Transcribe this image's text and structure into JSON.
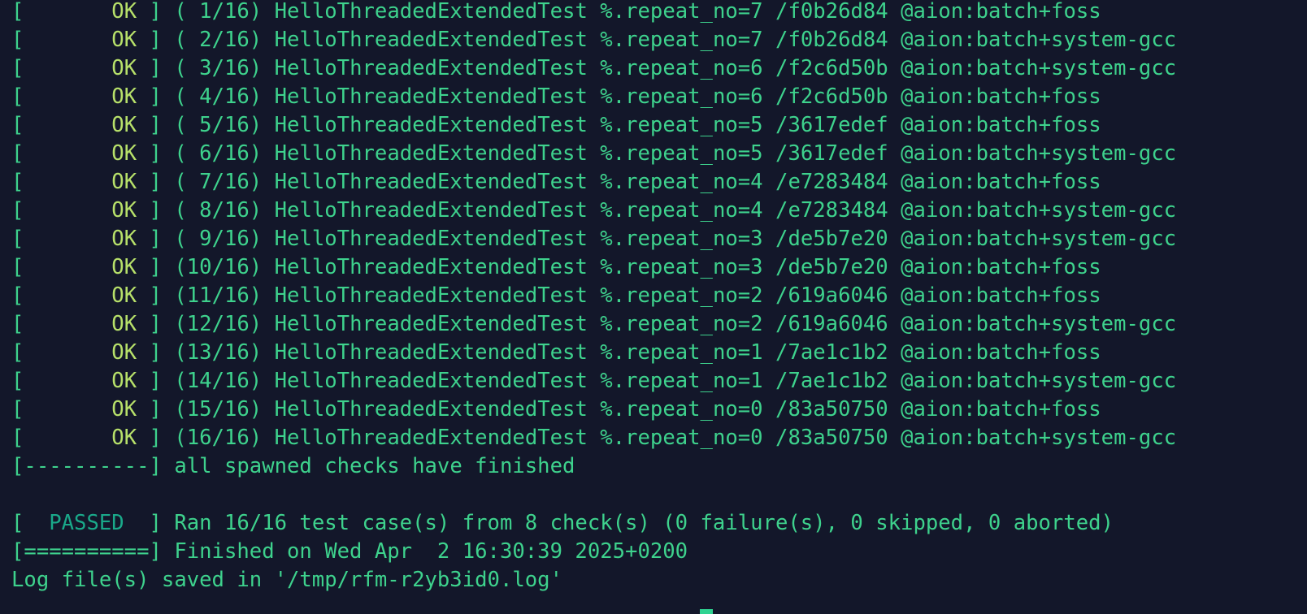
{
  "terminal": {
    "results": [
      {
        "status": "OK",
        "index": "( 1/16)",
        "test": "HelloThreadedExtendedTest",
        "param": "%.repeat_no=7",
        "hash": "/f0b26d84",
        "target": "@aion:batch+foss"
      },
      {
        "status": "OK",
        "index": "( 2/16)",
        "test": "HelloThreadedExtendedTest",
        "param": "%.repeat_no=7",
        "hash": "/f0b26d84",
        "target": "@aion:batch+system-gcc"
      },
      {
        "status": "OK",
        "index": "( 3/16)",
        "test": "HelloThreadedExtendedTest",
        "param": "%.repeat_no=6",
        "hash": "/f2c6d50b",
        "target": "@aion:batch+system-gcc"
      },
      {
        "status": "OK",
        "index": "( 4/16)",
        "test": "HelloThreadedExtendedTest",
        "param": "%.repeat_no=6",
        "hash": "/f2c6d50b",
        "target": "@aion:batch+foss"
      },
      {
        "status": "OK",
        "index": "( 5/16)",
        "test": "HelloThreadedExtendedTest",
        "param": "%.repeat_no=5",
        "hash": "/3617edef",
        "target": "@aion:batch+foss"
      },
      {
        "status": "OK",
        "index": "( 6/16)",
        "test": "HelloThreadedExtendedTest",
        "param": "%.repeat_no=5",
        "hash": "/3617edef",
        "target": "@aion:batch+system-gcc"
      },
      {
        "status": "OK",
        "index": "( 7/16)",
        "test": "HelloThreadedExtendedTest",
        "param": "%.repeat_no=4",
        "hash": "/e7283484",
        "target": "@aion:batch+foss"
      },
      {
        "status": "OK",
        "index": "( 8/16)",
        "test": "HelloThreadedExtendedTest",
        "param": "%.repeat_no=4",
        "hash": "/e7283484",
        "target": "@aion:batch+system-gcc"
      },
      {
        "status": "OK",
        "index": "( 9/16)",
        "test": "HelloThreadedExtendedTest",
        "param": "%.repeat_no=3",
        "hash": "/de5b7e20",
        "target": "@aion:batch+system-gcc"
      },
      {
        "status": "OK",
        "index": "(10/16)",
        "test": "HelloThreadedExtendedTest",
        "param": "%.repeat_no=3",
        "hash": "/de5b7e20",
        "target": "@aion:batch+foss"
      },
      {
        "status": "OK",
        "index": "(11/16)",
        "test": "HelloThreadedExtendedTest",
        "param": "%.repeat_no=2",
        "hash": "/619a6046",
        "target": "@aion:batch+foss"
      },
      {
        "status": "OK",
        "index": "(12/16)",
        "test": "HelloThreadedExtendedTest",
        "param": "%.repeat_no=2",
        "hash": "/619a6046",
        "target": "@aion:batch+system-gcc"
      },
      {
        "status": "OK",
        "index": "(13/16)",
        "test": "HelloThreadedExtendedTest",
        "param": "%.repeat_no=1",
        "hash": "/7ae1c1b2",
        "target": "@aion:batch+foss"
      },
      {
        "status": "OK",
        "index": "(14/16)",
        "test": "HelloThreadedExtendedTest",
        "param": "%.repeat_no=1",
        "hash": "/7ae1c1b2",
        "target": "@aion:batch+system-gcc"
      },
      {
        "status": "OK",
        "index": "(15/16)",
        "test": "HelloThreadedExtendedTest",
        "param": "%.repeat_no=0",
        "hash": "/83a50750",
        "target": "@aion:batch+foss"
      },
      {
        "status": "OK",
        "index": "(16/16)",
        "test": "HelloThreadedExtendedTest",
        "param": "%.repeat_no=0",
        "hash": "/83a50750",
        "target": "@aion:batch+system-gcc"
      }
    ],
    "finished_marker": "[----------]",
    "finished_text": "all spawned checks have finished",
    "passed_label": "PASSED",
    "summary_text": "Ran 16/16 test case(s) from 8 check(s) (0 failure(s), 0 skipped, 0 aborted)",
    "end_marker": "[==========]",
    "end_text": "Finished on Wed Apr  2 16:30:39 2025+0200",
    "log_text": "Log file(s) saved in '/tmp/rfm-r2yb3id0.log'"
  },
  "colors": {
    "background": "#13172a",
    "text_green": "#3ed28d",
    "ok_yellow_green": "#b7e06a",
    "passed_teal": "#1aa98a",
    "cursor": "#2fd391"
  }
}
